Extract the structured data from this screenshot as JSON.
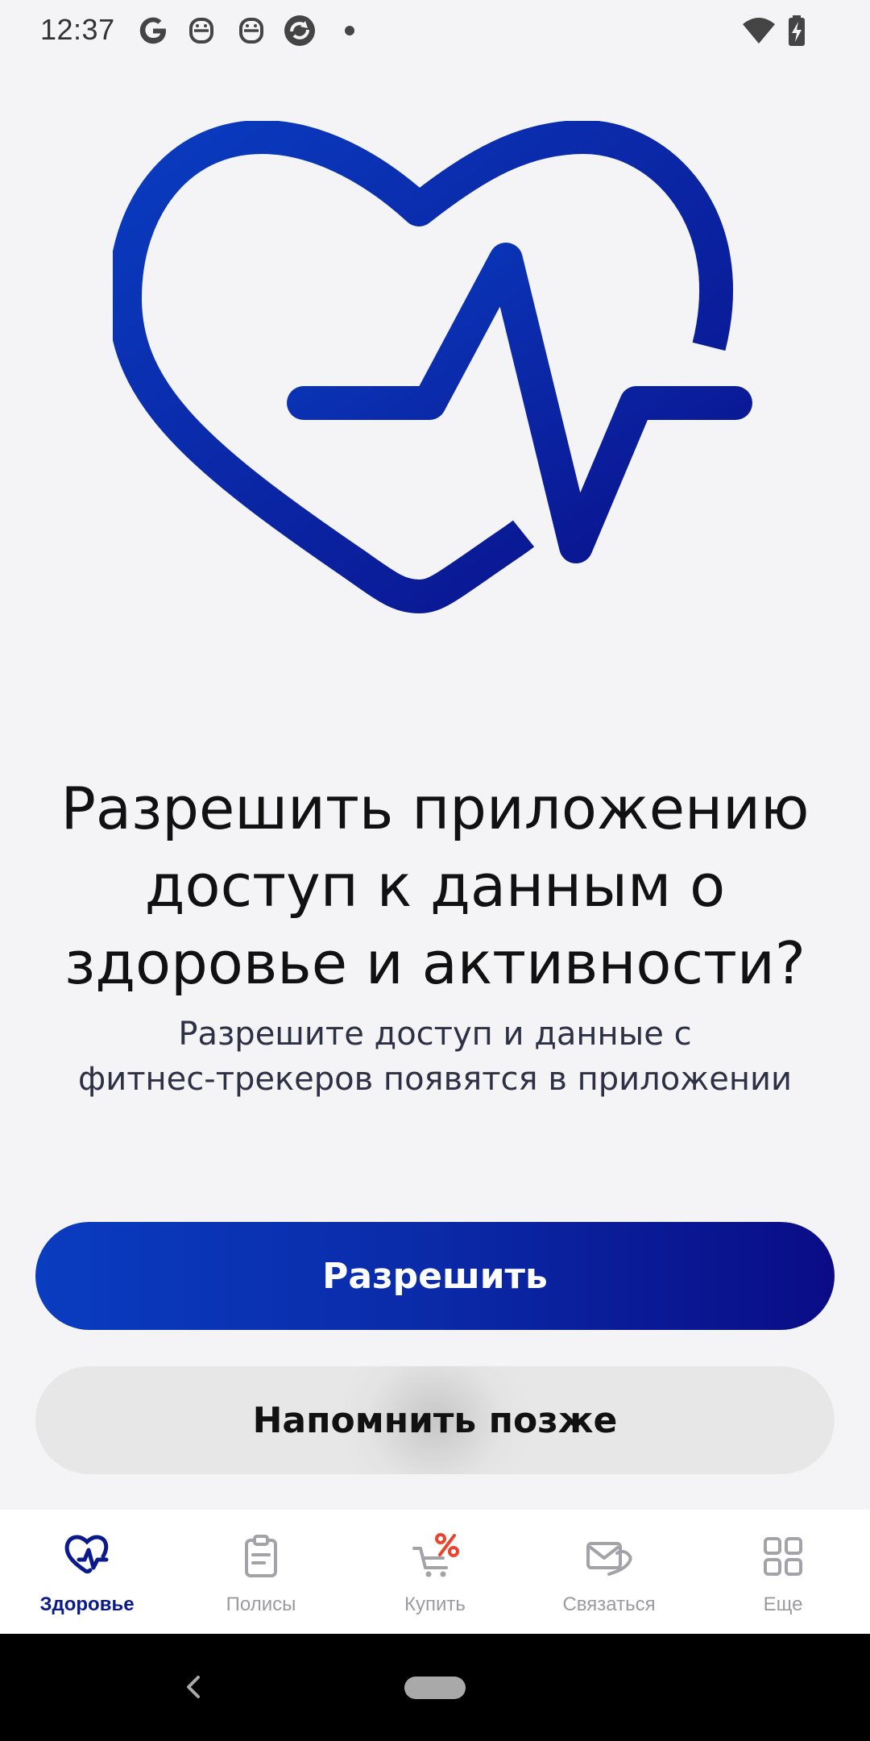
{
  "status_bar": {
    "time": "12:37",
    "icons": [
      "google-icon",
      "robot-icon",
      "robot-icon",
      "sync-icon",
      "dot-icon",
      "wifi-icon",
      "battery-charging-icon"
    ]
  },
  "hero": {
    "icon": "heart-pulse-icon"
  },
  "prompt": {
    "title_line1": "Разрешить приложению",
    "title_line2": "доступ к данным о",
    "title_line3": "здоровье и активности?",
    "subtitle_line1": "Разрешите доступ и данные с",
    "subtitle_line2": "фитнес-трекеров появятся в приложении"
  },
  "actions": {
    "allow_label": "Разрешить",
    "later_label": "Напомнить позже"
  },
  "tabbar": {
    "tabs": [
      {
        "label": "Здоровье",
        "icon": "heart-pulse-icon",
        "active": true
      },
      {
        "label": "Полисы",
        "icon": "clipboard-icon",
        "active": false
      },
      {
        "label": "Купить",
        "icon": "cart-percent-icon",
        "active": false
      },
      {
        "label": "Связаться",
        "icon": "envelope-phone-icon",
        "active": false
      },
      {
        "label": "Еще",
        "icon": "grid-icon",
        "active": false
      }
    ]
  },
  "colors": {
    "brand_blue": "#0a3cc0",
    "brand_navy": "#0a0c86",
    "accent_red": "#e8452c",
    "background": "#f4f4f6"
  }
}
